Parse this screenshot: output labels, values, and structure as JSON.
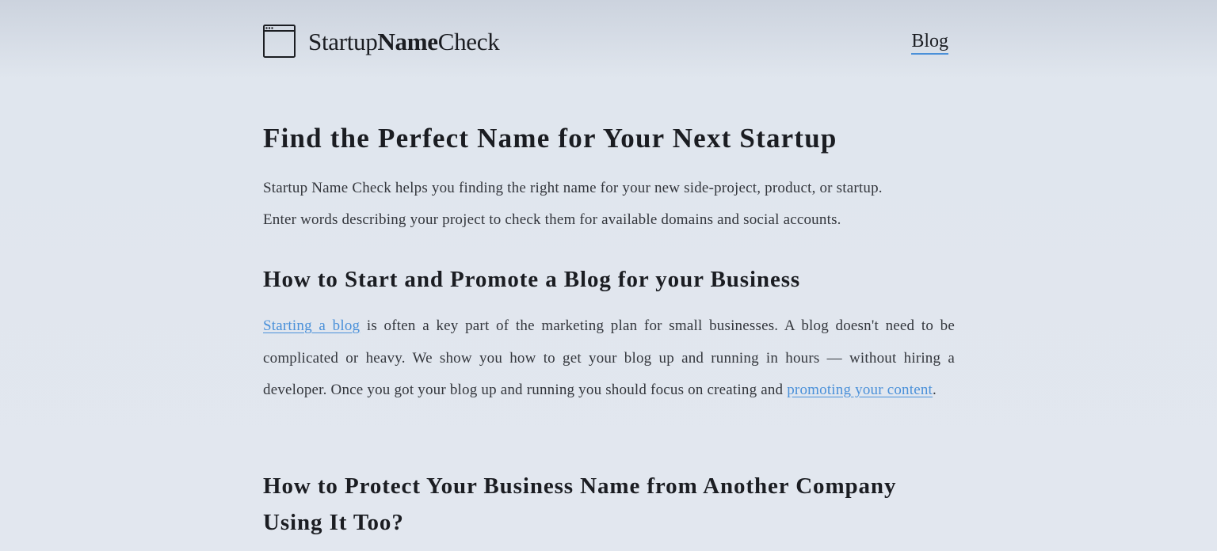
{
  "header": {
    "logo": {
      "icon": "browser-window-icon",
      "part1": "Startup",
      "part2": "Name",
      "part3": "Check"
    },
    "nav": {
      "blog_label": "Blog"
    }
  },
  "main": {
    "title": "Find the Perfect Name for Your Next Startup",
    "intro_line1": "Startup Name Check helps you finding the right name for your new side-project, product, or startup.",
    "intro_line2": "Enter words describing your project to check them for available domains and social accounts.",
    "section1": {
      "heading": "How to Start and Promote a Blog for your Business",
      "link1": "Starting a blog",
      "text1": " is often a key part of the marketing plan for small businesses. A blog doesn't need to be complicated or heavy. We show you how to get your blog up and running in hours — without hiring a developer. Once you got your blog up and running you should focus on creating and ",
      "link2": "promoting your content",
      "text2": "."
    },
    "section2": {
      "heading": "How to Protect Your Business Name from Another Company Using It Too?"
    }
  },
  "colors": {
    "link": "#4a90d9",
    "text": "#33363c",
    "heading": "#1b1d22"
  }
}
